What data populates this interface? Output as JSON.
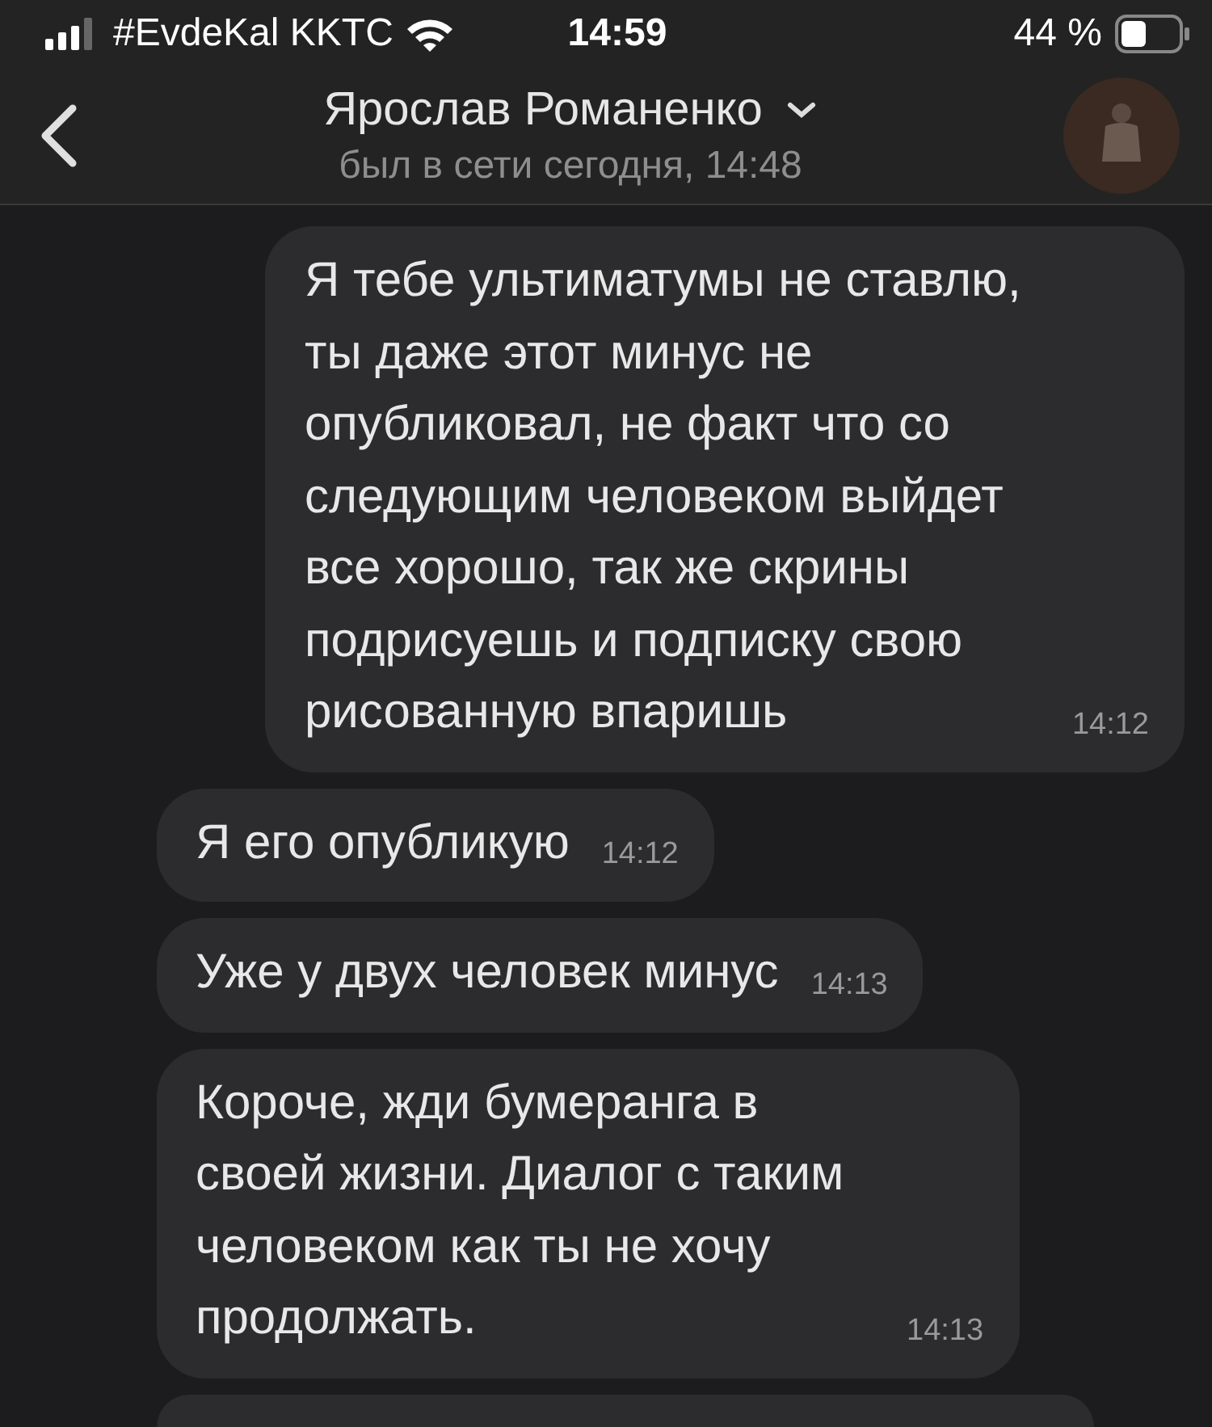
{
  "status_bar": {
    "carrier": "#EvdeKal KKTC",
    "time": "14:59",
    "battery": "44 %"
  },
  "header": {
    "name": "Ярослав Романенко",
    "status": "был в сети сегодня, 14:48"
  },
  "messages": [
    {
      "kind": "outgoing",
      "text": "Я тебе ультиматумы не ставлю, ты даже этот минус не опубликовал, не факт что со следующим человеком выйдет все хорошо, так же скрины подрисуешь и подписку свою рисованную впаришь",
      "time": "14:12"
    },
    {
      "kind": "incoming",
      "text": "Я его опубликую",
      "time": "14:12"
    },
    {
      "kind": "incoming",
      "text": "Уже у двух человек минус",
      "time": "14:13"
    },
    {
      "kind": "incoming",
      "text": "Короче, жди бумеранга в своей жизни. Диалог с таким человеком как ты не хочу продолжать.",
      "time": "14:13"
    }
  ]
}
